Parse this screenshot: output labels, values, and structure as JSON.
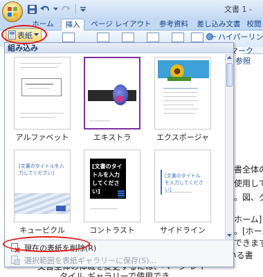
{
  "window": {
    "title": "文書 1 -"
  },
  "tabs": [
    {
      "label": "ホーム",
      "active": false
    },
    {
      "label": "挿入",
      "active": true
    },
    {
      "label": "ページ レイアウト",
      "active": false
    },
    {
      "label": "参考資料",
      "active": false
    },
    {
      "label": "差し込み文書",
      "active": false
    },
    {
      "label": "校閲",
      "active": false
    }
  ],
  "ribbon": {
    "table_button": "表紙",
    "hyperlink": "ハイパーリンク",
    "bookmark": "マーク",
    "cross_ref": "参照"
  },
  "gallery": {
    "header": "組み込み",
    "templates": [
      {
        "name": "アルファベット",
        "selected": false
      },
      {
        "name": "エキストラ",
        "selected": true
      },
      {
        "name": "エクスポージャ",
        "selected": false
      },
      {
        "name": "キュービクル",
        "selected": false
      },
      {
        "name": "コントラスト",
        "selected": false
      },
      {
        "name": "サイドライン",
        "selected": false
      }
    ],
    "thumb_text": {
      "cubicle": "[文書のタイトルを入力してください]",
      "contrast": "[文書のタイトルを入力してください]",
      "sideline": "[文書のタイトルを入力してください]"
    },
    "remove_item": "現在の表紙を削除(R)",
    "save_item": "選択範囲を表紙ギャラリーに保存(S)..."
  },
  "document": {
    "lines": [
      "書全体の体",
      "使用して",
      "。図、グ",
      "ホーム] タ",
      "。[ホーム",
      "できます",
      "用意されている書",
      "文書全体の体裁を変更するには、ページ レイ",
      "タイル ギャラリーで使用でき"
    ]
  },
  "colors": {
    "accent": "#15428b",
    "highlight_circle": "#e21515",
    "selected_border": "#7c2f9e"
  }
}
